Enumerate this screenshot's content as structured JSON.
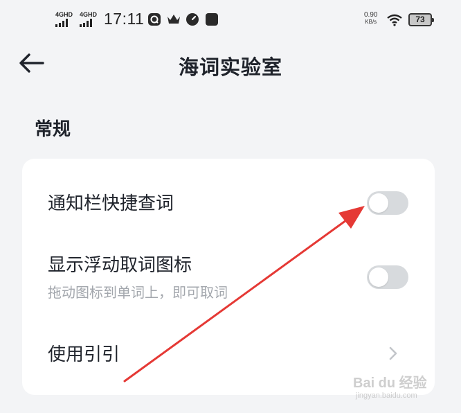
{
  "status_bar": {
    "signal_1": "4GHD",
    "signal_2": "4GHD",
    "time": "17:11",
    "icons": [
      "message-icon",
      "crown-icon",
      "speed-icon",
      "app-icon"
    ],
    "net_speed_value": "0.90",
    "net_speed_unit": "KB/s",
    "battery": "73"
  },
  "header": {
    "back_icon": "arrow-left-icon",
    "title": "海词实验室"
  },
  "section": {
    "title": "常规"
  },
  "settings": {
    "items": [
      {
        "label": "通知栏快捷查词",
        "type": "toggle",
        "enabled": false
      },
      {
        "label": "显示浮动取词图标",
        "subtitle": "拖动图标到单词上，即可取词",
        "type": "toggle",
        "enabled": false
      },
      {
        "label": "使用引引",
        "type": "link"
      }
    ]
  },
  "annotation": {
    "color": "#e53935"
  },
  "watermark": {
    "text": "Bai du 经验",
    "sub": "jingyan.baidu.com"
  }
}
